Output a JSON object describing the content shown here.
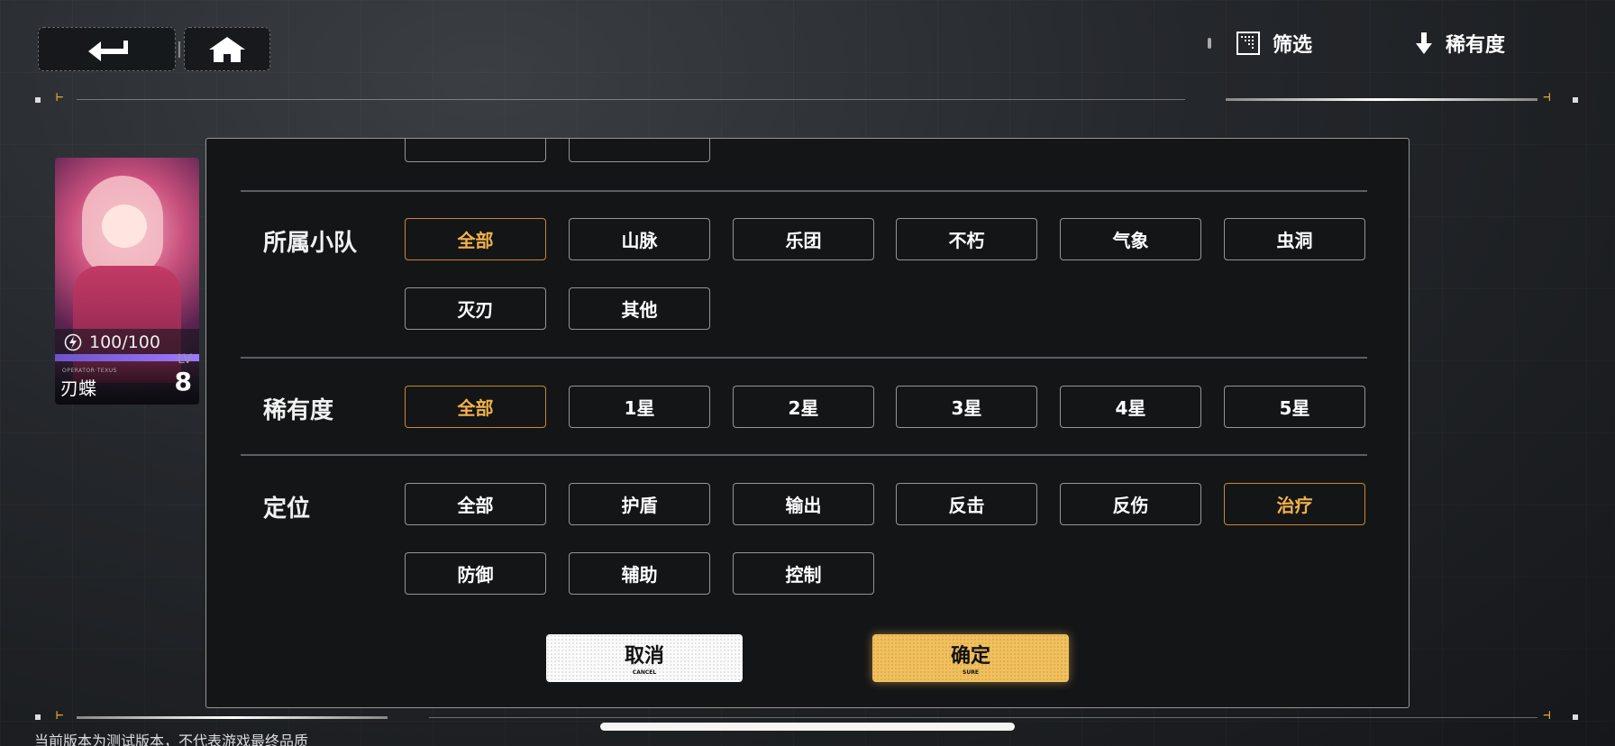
{
  "top_bar": {
    "filter_label": "筛选",
    "sort_label": "稀有度"
  },
  "character_card": {
    "energy": "100/100",
    "operator_tag": "OPERATOR·TEXUS",
    "name": "刃蝶",
    "level_label": "LV",
    "level": "8"
  },
  "filter_panel": {
    "squad": {
      "label": "所属小队",
      "options": [
        "全部",
        "山脉",
        "乐团",
        "不朽",
        "气象",
        "虫洞",
        "灭刃",
        "其他"
      ],
      "selected": "全部"
    },
    "rarity": {
      "label": "稀有度",
      "options": [
        "全部",
        "1星",
        "2星",
        "3星",
        "4星",
        "5星"
      ],
      "selected": "全部"
    },
    "role": {
      "label": "定位",
      "options": [
        "全部",
        "护盾",
        "输出",
        "反击",
        "反伤",
        "治疗",
        "防御",
        "辅助",
        "控制"
      ],
      "selected": "治疗"
    },
    "cancel": {
      "label": "取消",
      "sub": "CANCEL"
    },
    "confirm": {
      "label": "确定",
      "sub": "SURE"
    }
  },
  "footer_note": "当前版本为测试版本，不代表游戏最终品质",
  "colors": {
    "accent": "#f2c05c",
    "selected_text": "#f1b24a",
    "panel_bg": "#141517"
  }
}
